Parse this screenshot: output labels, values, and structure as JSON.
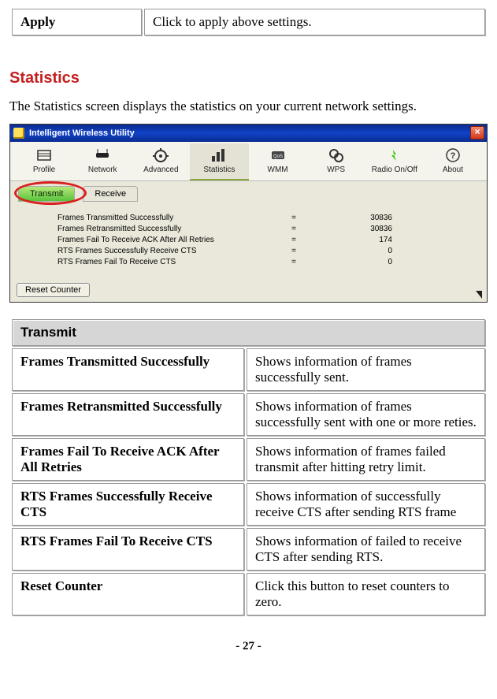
{
  "top_row": {
    "term": "Apply",
    "desc": "Click to apply above settings."
  },
  "section_title": "Statistics",
  "lead_text": "The Statistics screen displays the statistics on your current network settings.",
  "app": {
    "title": "Intelligent Wireless Utility",
    "close": "×",
    "tools": [
      {
        "label": "Profile"
      },
      {
        "label": "Network"
      },
      {
        "label": "Advanced"
      },
      {
        "label": "Statistics"
      },
      {
        "label": "WMM"
      },
      {
        "label": "WPS"
      },
      {
        "label": "Radio On/Off"
      },
      {
        "label": "About"
      }
    ],
    "subtabs": {
      "transmit": "Transmit",
      "receive": "Receive"
    },
    "stats": [
      {
        "label": "Frames Transmitted Successfully",
        "eq": "=",
        "val": "30836"
      },
      {
        "label": "Frames Retransmitted Successfully",
        "eq": "=",
        "val": "30836"
      },
      {
        "label": "Frames Fail To Receive ACK After All Retries",
        "eq": "=",
        "val": "174"
      },
      {
        "label": "RTS Frames Successfully Receive CTS",
        "eq": "=",
        "val": "0"
      },
      {
        "label": "RTS Frames Fail To Receive CTS",
        "eq": "=",
        "val": "0"
      }
    ],
    "reset": "Reset Counter"
  },
  "def": {
    "header": "Transmit",
    "rows": [
      {
        "term": "Frames Transmitted Successfully",
        "desc": "Shows information of frames successfully sent."
      },
      {
        "term": "Frames Retransmitted Successfully",
        "desc": "Shows information of frames successfully sent with one or more reties."
      },
      {
        "term": "Frames Fail To Receive ACK After All Retries",
        "desc": "Shows information of frames failed transmit after hitting retry limit."
      },
      {
        "term": "RTS Frames Successfully Receive CTS",
        "desc": "Shows information of successfully receive CTS after sending RTS frame"
      },
      {
        "term": "RTS Frames Fail To Receive CTS",
        "desc": "Shows information of failed to receive CTS after sending RTS."
      },
      {
        "term": "Reset Counter",
        "desc": "Click this button to reset counters to zero."
      }
    ]
  },
  "page_number": "- 27 -"
}
